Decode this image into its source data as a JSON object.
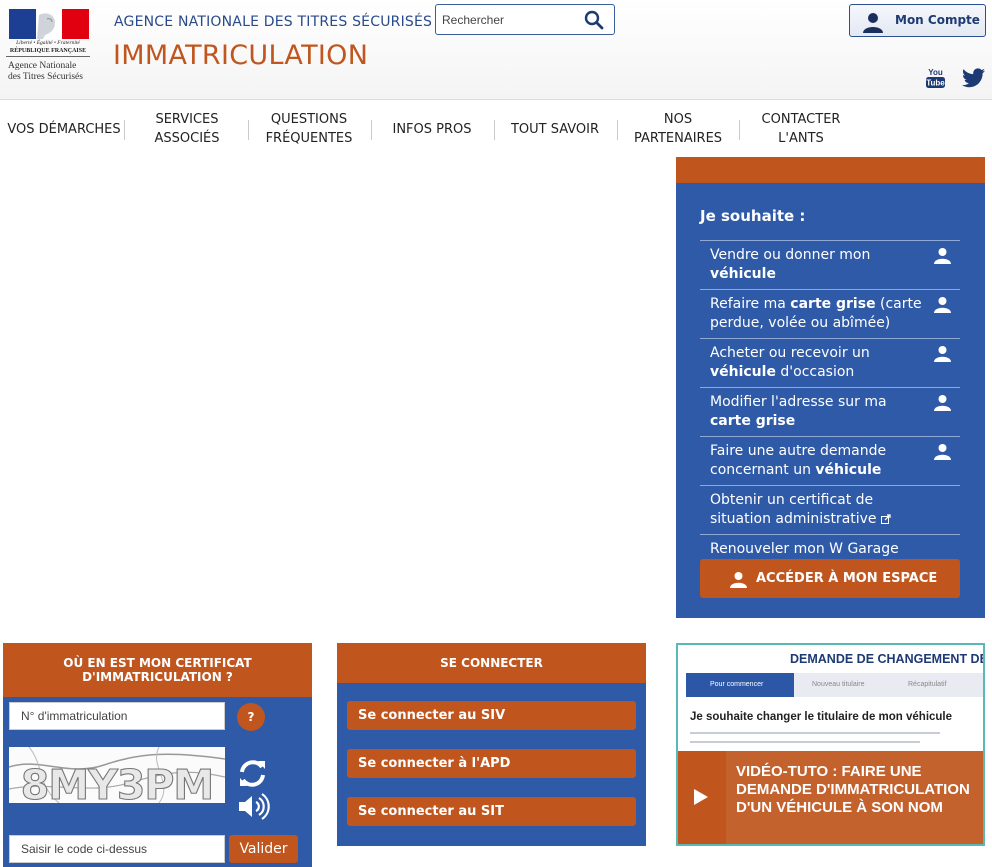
{
  "header": {
    "logo": {
      "motto": "Liberté • Égalité • Fraternité",
      "republic": "RÉPUBLIQUE FRANÇAISE",
      "agency_line1": "Agence Nationale",
      "agency_line2": "des Titres Sécurisés"
    },
    "agency_name": "AGENCE NATIONALE DES TITRES SÉCURISÉS",
    "site_title": "IMMATRICULATION",
    "search_placeholder": "Rechercher",
    "account_label": "Mon Compte",
    "social": [
      "youtube-icon",
      "twitter-icon"
    ]
  },
  "nav": {
    "items": [
      {
        "label": "VOS DÉMARCHES"
      },
      {
        "label": "SERVICES ASSOCIÉS"
      },
      {
        "label": "QUESTIONS FRÉQUENTES"
      },
      {
        "label": "INFOS PROS"
      },
      {
        "label": "TOUT SAVOIR"
      },
      {
        "label": "NOS PARTENAIRES"
      },
      {
        "label": "CONTACTER L'ANTS"
      }
    ]
  },
  "wish_panel": {
    "title": "Je souhaite :",
    "items": [
      {
        "pre": "Vendre ou donner mon ",
        "bold": "véhicule",
        "post": "",
        "icon": "user-icon"
      },
      {
        "pre": "Refaire ma ",
        "bold": "carte grise",
        "post": " (carte perdue, volée ou abîmée)",
        "icon": "user-icon"
      },
      {
        "pre": "Acheter ou recevoir un ",
        "bold": "véhicule",
        "post": " d'occasion",
        "icon": "user-icon"
      },
      {
        "pre": "Modifier l'adresse sur ma ",
        "bold": "carte grise",
        "post": "",
        "icon": "user-icon"
      },
      {
        "pre": "Faire une autre demande concernant un ",
        "bold": "véhicule",
        "post": "",
        "icon": "user-icon"
      },
      {
        "pre": "Obtenir un certificat de situation administrative",
        "bold": "",
        "post": "",
        "icon": "external-link-icon"
      },
      {
        "pre": "Renouveler mon W Garage",
        "bold": "",
        "post": "",
        "icon": ""
      }
    ],
    "access_button": "ACCÉDER À MON ESPACE"
  },
  "certificate_box": {
    "title_line1": "OÙ EN EST MON CERTIFICAT",
    "title_line2": "D'IMMATRICULATION ?",
    "immat_placeholder": "N° d'immatriculation",
    "help_label": "?",
    "captcha_text": "8MY3PM",
    "code_placeholder": "Saisir le code ci-dessus",
    "validate_label": "Valider"
  },
  "connect_box": {
    "title": "SE CONNECTER",
    "buttons": [
      {
        "label": "Se connecter au SIV"
      },
      {
        "label": "Se connecter à l'APD"
      },
      {
        "label": "Se connecter au SIT"
      }
    ]
  },
  "video_box": {
    "screenshot_title": "DEMANDE DE CHANGEMENT DE",
    "tabs": [
      "Pour commencer",
      "Nouveau titulaire",
      "Récapitulatif"
    ],
    "screenshot_heading": "Je souhaite changer le titulaire de mon véhicule",
    "caption": "VIDÉO-TUTO : FAIRE UNE DEMANDE D'IMMATRICULATION D'UN VÉHICULE À SON NOM"
  },
  "colors": {
    "brand_blue": "#2f5aa8",
    "brand_orange": "#c0561e",
    "title_blue": "#2a4a8a"
  }
}
